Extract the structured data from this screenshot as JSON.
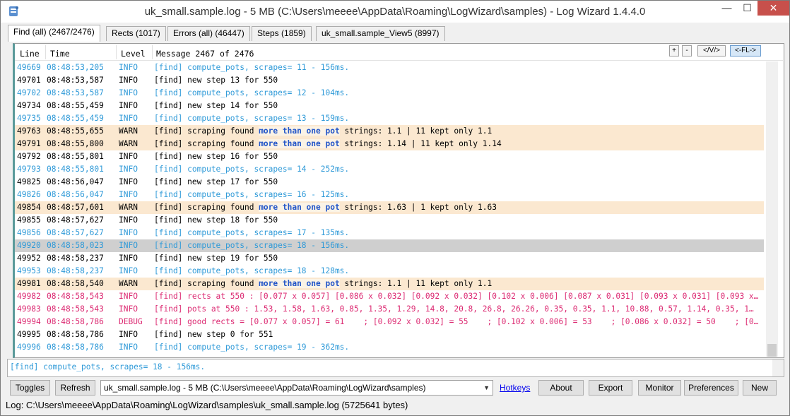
{
  "window": {
    "title": "uk_small.sample.log - 5 MB (C:\\Users\\meeee\\AppData\\Roaming\\LogWizard\\samples) - Log Wizard 1.4.4.0",
    "min_glyph": "—",
    "max_glyph": "☐",
    "close_glyph": "✕"
  },
  "tabs": [
    {
      "label": "Find (all) (2467/2476)"
    },
    {
      "label": "Rects (1017)"
    },
    {
      "label": "Errors (all) (46447)"
    },
    {
      "label": "Steps (1859)"
    },
    {
      "label": "uk_small.sample_View5 (8997)"
    }
  ],
  "header": {
    "line": "Line",
    "time": "Time",
    "level": "Level",
    "message": "Message 2467 of 2476",
    "btn_plus": "+",
    "btn_minus": "-",
    "btn_view": "</V/>",
    "btn_fl": "<-FL->"
  },
  "log_rows": [
    {
      "line": "49669",
      "time": "08:48:53,205",
      "level": "INFO",
      "msg": "[find] compute_pots, scrapes= 11 - 156ms.",
      "kind": "info"
    },
    {
      "line": "49701",
      "time": "08:48:53,587",
      "level": "INFO",
      "msg": "[find] new step 13 for 550",
      "kind": "plain"
    },
    {
      "line": "49702",
      "time": "08:48:53,587",
      "level": "INFO",
      "msg": "[find] compute_pots, scrapes= 12 - 104ms.",
      "kind": "info"
    },
    {
      "line": "49734",
      "time": "08:48:55,459",
      "level": "INFO",
      "msg": "[find] new step 14 for 550",
      "kind": "plain"
    },
    {
      "line": "49735",
      "time": "08:48:55,459",
      "level": "INFO",
      "msg": "[find] compute_pots, scrapes= 13 - 159ms.",
      "kind": "info"
    },
    {
      "line": "49763",
      "time": "08:48:55,655",
      "level": "WARN",
      "msg_pre": "[find] scraping found ",
      "msg_hl": "more than one pot",
      "msg_post": " strings: 1.1 | 11 kept only 1.1",
      "kind": "warn"
    },
    {
      "line": "49791",
      "time": "08:48:55,800",
      "level": "WARN",
      "msg_pre": "[find] scraping found ",
      "msg_hl": "more than one pot",
      "msg_post": " strings: 1.14 | 11 kept only 1.14",
      "kind": "warn"
    },
    {
      "line": "49792",
      "time": "08:48:55,801",
      "level": "INFO",
      "msg": "[find] new step 16 for 550",
      "kind": "plain"
    },
    {
      "line": "49793",
      "time": "08:48:55,801",
      "level": "INFO",
      "msg": "[find] compute_pots, scrapes= 14 - 252ms.",
      "kind": "info"
    },
    {
      "line": "49825",
      "time": "08:48:56,047",
      "level": "INFO",
      "msg": "[find] new step 17 for 550",
      "kind": "plain"
    },
    {
      "line": "49826",
      "time": "08:48:56,047",
      "level": "INFO",
      "msg": "[find] compute_pots, scrapes= 16 - 125ms.",
      "kind": "info"
    },
    {
      "line": "49854",
      "time": "08:48:57,601",
      "level": "WARN",
      "msg_pre": "[find] scraping found ",
      "msg_hl": "more than one pot",
      "msg_post": " strings: 1.63 | 1 kept only 1.63",
      "kind": "warn"
    },
    {
      "line": "49855",
      "time": "08:48:57,627",
      "level": "INFO",
      "msg": "[find] new step 18 for 550",
      "kind": "plain"
    },
    {
      "line": "49856",
      "time": "08:48:57,627",
      "level": "INFO",
      "msg": "[find] compute_pots, scrapes= 17 - 135ms.",
      "kind": "info"
    },
    {
      "line": "49920",
      "time": "08:48:58,023",
      "level": "INFO",
      "msg": "[find] compute_pots, scrapes= 18 - 156ms.",
      "kind": "sel"
    },
    {
      "line": "49952",
      "time": "08:48:58,237",
      "level": "INFO",
      "msg": "[find] new step 19 for 550",
      "kind": "plain"
    },
    {
      "line": "49953",
      "time": "08:48:58,237",
      "level": "INFO",
      "msg": "[find] compute_pots, scrapes= 18 - 128ms.",
      "kind": "info"
    },
    {
      "line": "49981",
      "time": "08:48:58,540",
      "level": "WARN",
      "msg_pre": "[find] scraping found ",
      "msg_hl": "more than one pot",
      "msg_post": " strings: 1.1 | 11 kept only 1.1",
      "kind": "warn"
    },
    {
      "line": "49982",
      "time": "08:48:58,543",
      "level": "INFO",
      "msg": "[find] rects at 550 : [0.077 x 0.057] [0.086 x 0.032] [0.092 x 0.032] [0.102 x 0.006] [0.087 x 0.031] [0.093 x 0.031] [0.093 x…",
      "kind": "pink"
    },
    {
      "line": "49983",
      "time": "08:48:58,543",
      "level": "INFO",
      "msg": "[find] pots at 550 : 1.53, 1.58, 1.63, 0.85, 1.35, 1.29, 14.8, 20.8, 26.8, 26.26, 0.35, 0.35, 1.1, 10.88, 0.57, 1.14, 0.35, 1…",
      "kind": "pink"
    },
    {
      "line": "49994",
      "time": "08:48:58,786",
      "level": "DEBUG",
      "msg": "[find] good rects = [0.077 x 0.057] = 61    ; [0.092 x 0.032] = 55    ; [0.102 x 0.006] = 53    ; [0.086 x 0.032] = 50    ; [0…",
      "kind": "pink"
    },
    {
      "line": "49995",
      "time": "08:48:58,786",
      "level": "INFO",
      "msg": "[find] new step 0 for 551",
      "kind": "plain"
    },
    {
      "line": "49996",
      "time": "08:48:58,786",
      "level": "INFO",
      "msg": "[find] compute_pots, scrapes= 19 - 362ms.",
      "kind": "info"
    }
  ],
  "details_text": "[find] compute_pots, scrapes= 18 - 156ms.",
  "bottom": {
    "toggles": "Toggles",
    "refresh": "Refresh",
    "log_select": "uk_small.sample.log - 5 MB (C:\\Users\\meeee\\AppData\\Roaming\\LogWizard\\samples)",
    "hotkeys": "Hotkeys",
    "about": "About",
    "export": "Export",
    "monitor": "Monitor",
    "preferences": "Preferences",
    "new": "New"
  },
  "status": "Log: C:\\Users\\meeee\\AppData\\Roaming\\LogWizard\\samples\\uk_small.sample.log (5725641 bytes)",
  "colors": {
    "info": "#2f9ad8",
    "warn_bg": "#fbe8d0",
    "highlight": "#2255c8",
    "pink": "#dc2a72",
    "selected_bg": "#cfcfcf",
    "close_btn": "#c7504b"
  },
  "icons": {
    "app": "log-wizard-app-icon",
    "dropdown": "chevron-down-icon"
  }
}
